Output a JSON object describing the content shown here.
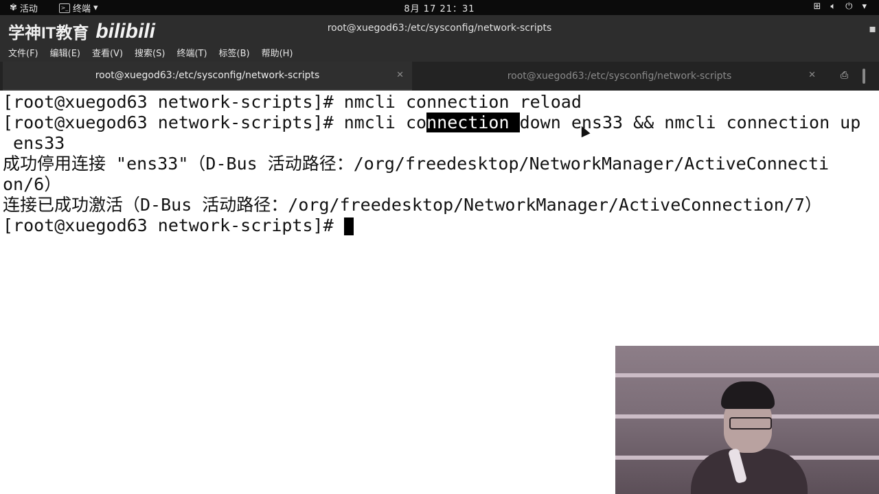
{
  "topbar": {
    "activities": "活动",
    "app_menu": "终端",
    "clock": "8月 17  21：31"
  },
  "window": {
    "logo_text": "学神IT教育",
    "logo_brand": "bilibili",
    "title": "root@xuegod63:/etc/sysconfig/network-scripts"
  },
  "menu": {
    "items": [
      "文件(F)",
      "编辑(E)",
      "查看(V)",
      "搜索(S)",
      "终端(T)",
      "标签(B)",
      "帮助(H)"
    ]
  },
  "tabs": [
    {
      "label": "root@xuegod63:/etc/sysconfig/network-scripts",
      "active": true
    },
    {
      "label": "root@xuegod63:/etc/sysconfig/network-scripts",
      "active": false
    }
  ],
  "terminal": {
    "line1": "[root@xuegod63 network-scripts]# nmcli connection reload",
    "line2_pre": "[root@xuegod63 network-scripts]# nmcli co",
    "line2_sel": "nnection ",
    "line2_post": "down ens33 && nmcli connection up",
    "line3": " ens33",
    "line4": "成功停用连接 \"ens33\"（D-Bus 活动路径：/org/freedesktop/NetworkManager/ActiveConnecti",
    "line5": "on/6）",
    "line6": "连接已成功激活（D-Bus 活动路径：/org/freedesktop/NetworkManager/ActiveConnection/7）",
    "prompt": "[root@xuegod63 network-scripts]# "
  }
}
